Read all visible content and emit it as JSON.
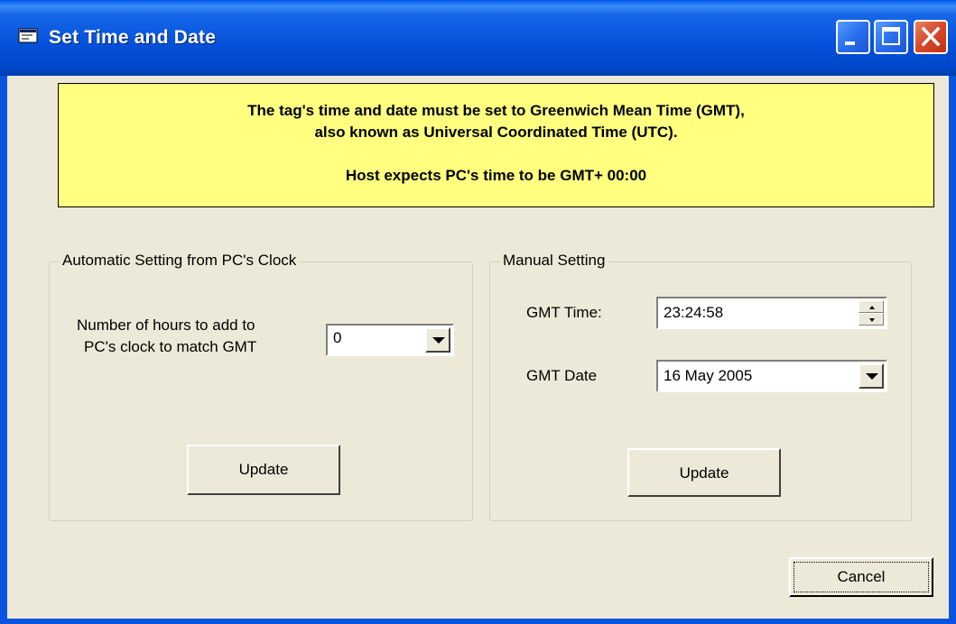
{
  "window": {
    "title": "Set Time and Date",
    "controls": {
      "minimize": "minimize-icon",
      "maximize": "maximize-icon",
      "close": "close-icon"
    }
  },
  "banner": {
    "line1": "The tag's time and date must be set to Greenwich Mean Time (GMT),",
    "line2": "also known as Universal Coordinated Time (UTC).",
    "line3": "Host expects PC's time to be GMT+ 00:00"
  },
  "automatic": {
    "legend": "Automatic Setting from PC's Clock",
    "hours_label_line1": "Number of hours to add to",
    "hours_label_line2": "PC's clock to match GMT",
    "hours_value": "0",
    "update_label": "Update"
  },
  "manual": {
    "legend": "Manual Setting",
    "time_label": "GMT Time:",
    "time_value": "23:24:58",
    "date_label": "GMT Date",
    "date_value": "16 May 2005",
    "update_label": "Update"
  },
  "cancel_label": "Cancel",
  "colors": {
    "banner_bg": "#FFFF80",
    "dialog_bg": "#ECE9D8",
    "titlebar": "#0A53E0"
  }
}
